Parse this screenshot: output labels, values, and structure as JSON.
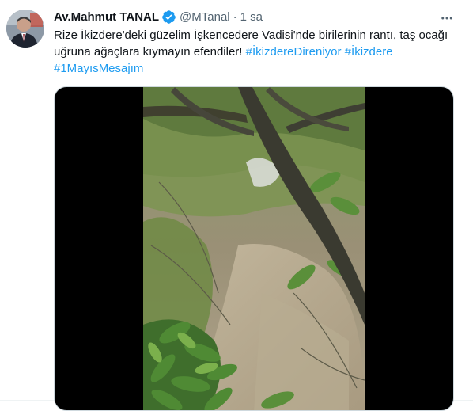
{
  "tweet": {
    "author": {
      "name": "Av.Mahmut TANAL",
      "handle": "@MTanal",
      "verified": true,
      "avatar_icon": "profile-photo-icon"
    },
    "separator": "·",
    "time": "1 sa",
    "text": {
      "line1": "Rize İkizdere'deki güzelim İşkencedere Vadisi'nde birilerinin rantı, taş ocağı",
      "line2_prefix": "uğruna ağaçlara kıymayın efendiler! ",
      "hashtags": [
        "#İkizdereDireniyor",
        "#İkizdere",
        "#1MayısMesajım"
      ]
    },
    "media": {
      "type": "video",
      "icon": "video-player-icon"
    },
    "more_icon": "more-horizontal-icon",
    "colors": {
      "accent": "#1d9bf0",
      "secondary_text": "#536471",
      "primary_text": "#0f1419"
    }
  }
}
